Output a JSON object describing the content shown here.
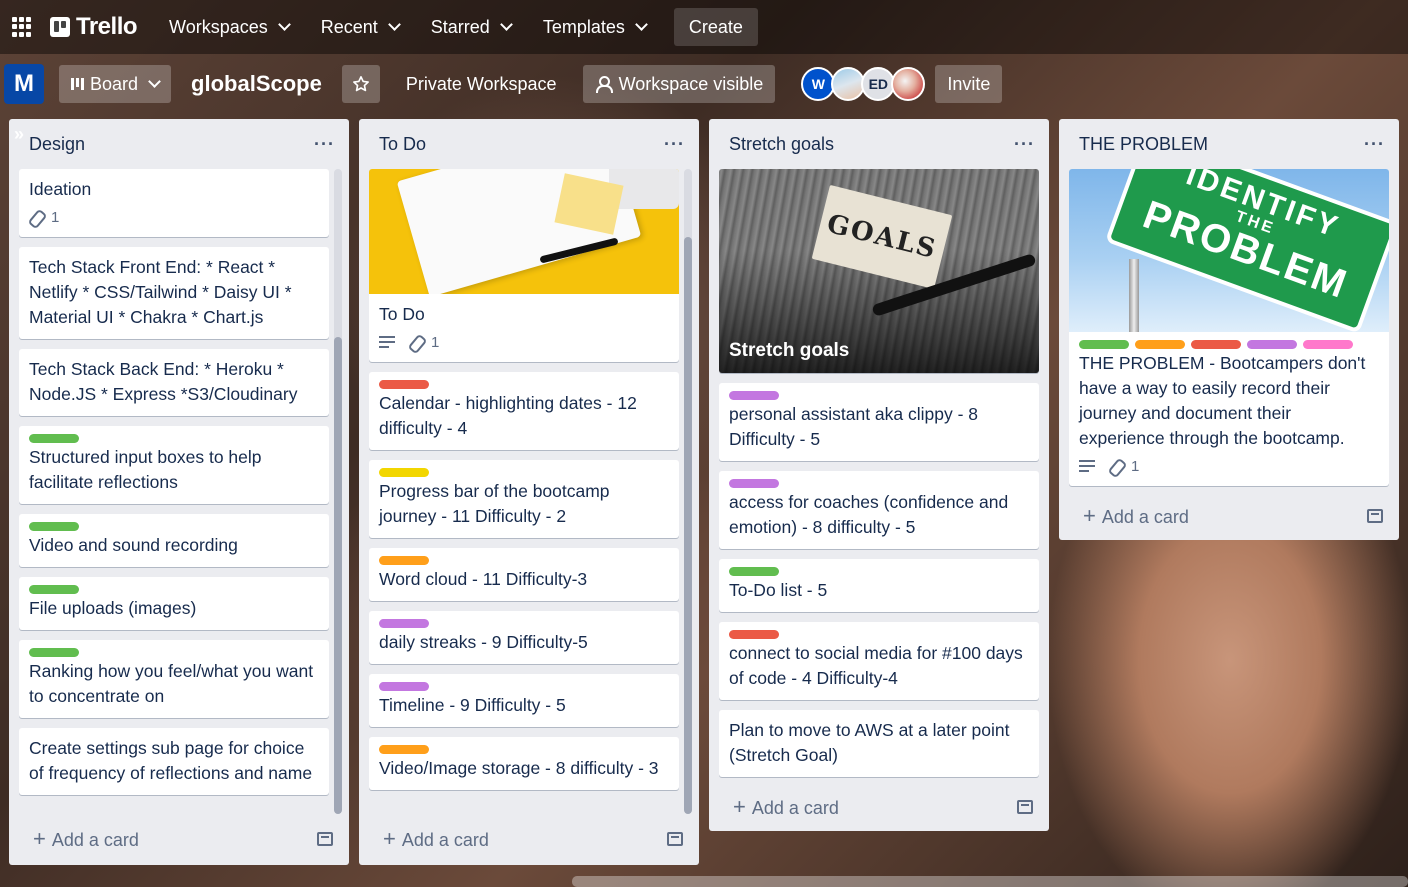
{
  "topbar": {
    "logo": "Trello",
    "nav": [
      "Workspaces",
      "Recent",
      "Starred",
      "Templates"
    ],
    "create": "Create"
  },
  "boardbar": {
    "workspace_initial": "M",
    "view": "Board",
    "title": "globalScope",
    "private_workspace": "Private Workspace",
    "visibility": "Workspace visible",
    "members": [
      "W",
      "",
      "ED",
      ""
    ],
    "invite": "Invite"
  },
  "colors": {
    "green": "#61bd4f",
    "red": "#eb5a46",
    "yellow": "#f2d600",
    "orange": "#ff9f1a",
    "purple": "#c377e0",
    "pink": "#ff78cb"
  },
  "lists": [
    {
      "title": "Design",
      "add_card": "Add a card",
      "cards": [
        {
          "text": "Ideation",
          "attachments": "1"
        },
        {
          "text": "Tech Stack Front End: * React * Netlify * CSS/Tailwind * Daisy UI * Material UI * Chakra * Chart.js"
        },
        {
          "text": "Tech Stack Back End: * Heroku * Node.JS * Express *S3/Cloudinary"
        },
        {
          "text": "Structured input boxes to help facilitate reflections",
          "label": "green"
        },
        {
          "text": "Video and sound recording",
          "label": "green"
        },
        {
          "text": "File uploads (images)",
          "label": "green"
        },
        {
          "text": "Ranking how you feel/what you want to concentrate on",
          "label": "green"
        },
        {
          "text": "Create settings sub page for choice of frequency of reflections and name"
        }
      ]
    },
    {
      "title": "To Do",
      "add_card": "Add a card",
      "cards": [
        {
          "text": "To Do",
          "attachments": "1"
        },
        {
          "text": "Calendar - highlighting dates - 12 difficulty - 4",
          "label": "red"
        },
        {
          "text": "Progress bar of the bootcamp journey - 11 Difficulty - 2",
          "label": "yellow"
        },
        {
          "text": "Word cloud - 11 Difficulty-3",
          "label": "orange"
        },
        {
          "text": "daily streaks - 9 Difficulty-5",
          "label": "purple"
        },
        {
          "text": "Timeline - 9 Difficulty - 5",
          "label": "purple"
        },
        {
          "text": "Video/Image storage - 8 difficulty - 3",
          "label": "orange"
        }
      ]
    },
    {
      "title": "Stretch goals",
      "add_card": "Add a card",
      "cover_word": "GOALS",
      "cards": [
        {
          "text": "Stretch goals"
        },
        {
          "text": "personal assistant aka clippy - 8 Difficulty - 5",
          "label": "purple"
        },
        {
          "text": "access for coaches (confidence and emotion) - 8 difficulty - 5",
          "label": "purple"
        },
        {
          "text": "To-Do list - 5",
          "label": "green"
        },
        {
          "text": "connect to social media for #100 days of code - 4 Difficulty-4",
          "label": "red"
        },
        {
          "text": "Plan to move to AWS at a later point (Stretch Goal)"
        }
      ]
    },
    {
      "title": "THE PROBLEM",
      "add_card": "Add a card",
      "cover_sign": [
        "IDENTIFY",
        "THE",
        "PROBLEM"
      ],
      "cards": [
        {
          "text": "THE PROBLEM - Bootcampers don't have a way to easily record their journey and document their experience through the bootcamp.",
          "attachments": "1"
        }
      ]
    }
  ]
}
